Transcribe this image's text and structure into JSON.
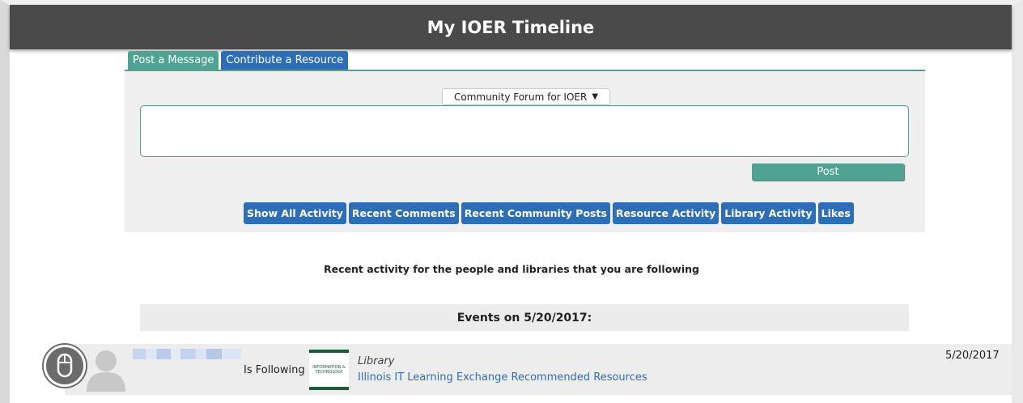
{
  "header": {
    "title": "My IOER Timeline"
  },
  "tabs": [
    {
      "label": "Post a Message",
      "active": true
    },
    {
      "label": "Contribute a Resource",
      "active": false
    }
  ],
  "composer": {
    "forum_select": "Community Forum for IOER",
    "message_value": "",
    "post_label": "Post"
  },
  "filters": [
    "Show All Activity",
    "Recent Comments",
    "Recent Community Posts",
    "Resource Activity",
    "Library Activity",
    "Likes"
  ],
  "intro_text": "Recent activity for the people and libraries that you are following",
  "events": {
    "heading": "Events on 5/20/2017:",
    "items": [
      {
        "action": "Is Following",
        "thumb_text": "INFORMATION & TECHNOLOGY",
        "type": "Library",
        "title": "Illinois IT Learning Exchange Recommended Resources",
        "date": "5/20/2017"
      }
    ]
  },
  "colors": {
    "header_bg": "#4a4a4a",
    "accent_green": "#4ea392",
    "accent_blue": "#2e6eb5"
  }
}
